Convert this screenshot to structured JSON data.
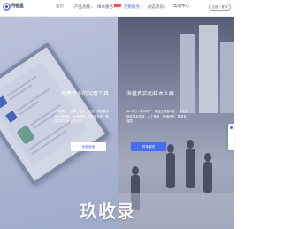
{
  "brand": {
    "name": "问卷星",
    "accent": "#4a6cf2"
  },
  "nav": {
    "items": [
      {
        "label": "首页"
      },
      {
        "label": "产品功能"
      },
      {
        "label": "样本服务"
      },
      {
        "label": "定制服务"
      },
      {
        "label": "动态资讯"
      },
      {
        "label": "帮助中心"
      }
    ],
    "login_label": "注册 / 登录"
  },
  "hero_left": {
    "title": "免费专业的问卷工具",
    "description": "在线调查、投票、测评、考试、报名等多种应用场景，免费使用，无限量发布，数据实时同步呈现分析",
    "button_label": "免费使用"
  },
  "hero_right": {
    "title": "海量真实的样本人群",
    "description": "6200万+样本用户，覆盖全国各地区，多行业精准样本投放，人工审核，快速回收，质量有保障",
    "button_label": "样本服务"
  },
  "watermark": {
    "text": "玖收录"
  }
}
